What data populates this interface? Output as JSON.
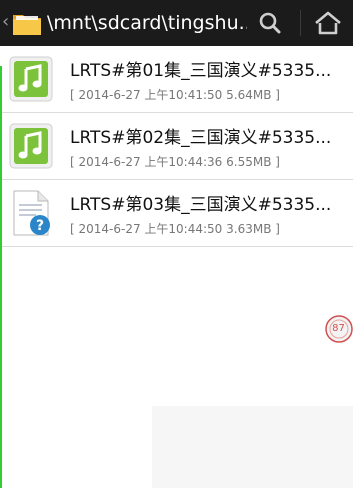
{
  "header": {
    "back_icon": "chevron-left-icon",
    "folder_icon": "folder-icon",
    "path": "\\mnt\\sdcard\\tingshu...",
    "search_icon": "search-icon",
    "home_icon": "home-icon"
  },
  "files": [
    {
      "icon": "audio-file-icon",
      "name": "LRTS#第01集_三国演义#5335...",
      "meta": "[ 2014-6-27 上午10:41:50 5.64MB ]"
    },
    {
      "icon": "audio-file-icon",
      "name": "LRTS#第02集_三国演义#5335...",
      "meta": "[ 2014-6-27 上午10:44:36 6.55MB ]"
    },
    {
      "icon": "unknown-file-icon",
      "name": "LRTS#第03集_三国演义#5335...",
      "meta": "[ 2014-6-27 上午10:44:50 3.63MB ]"
    }
  ],
  "pager": {
    "value": "87"
  },
  "colors": {
    "topbar": "#1b1b1b",
    "accent": "#33cc33",
    "music_green": "#7cc23a",
    "badge_blue": "#2a86c8"
  }
}
